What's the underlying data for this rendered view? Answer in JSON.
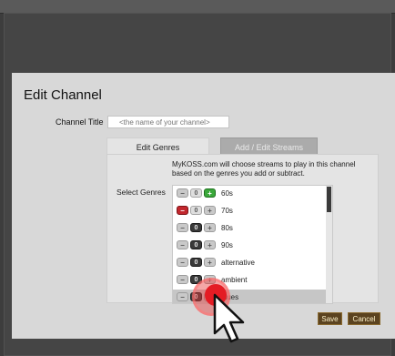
{
  "dialog": {
    "title": "Edit Channel",
    "channel_title_label": "Channel Title",
    "channel_title_placeholder": "<the name of your channel>"
  },
  "tabs": {
    "edit_genres": "Edit Genres",
    "add_edit_streams": "Add / Edit Streams"
  },
  "panel": {
    "description": "MyKOSS.com will choose streams to play in this channel based on the genres you add or subtract.",
    "select_genres_label": "Select Genres"
  },
  "genre_buttons": {
    "minus": "−",
    "zero": "0",
    "plus": "+"
  },
  "genres": [
    {
      "name": "60s",
      "state": "plus"
    },
    {
      "name": "70s",
      "state": "minus"
    },
    {
      "name": "80s",
      "state": "zero"
    },
    {
      "name": "90s",
      "state": "zero"
    },
    {
      "name": "alternative",
      "state": "zero"
    },
    {
      "name": "ambient",
      "state": "zero"
    },
    {
      "name": "blues",
      "state": "zero"
    }
  ],
  "actions": {
    "save": "Save",
    "cancel": "Cancel"
  },
  "colors": {
    "minus_active": "#c2272d",
    "plus_active": "#3aa83a",
    "zero_active": "#3a3a3a",
    "click_indicator": "#e41c24"
  }
}
